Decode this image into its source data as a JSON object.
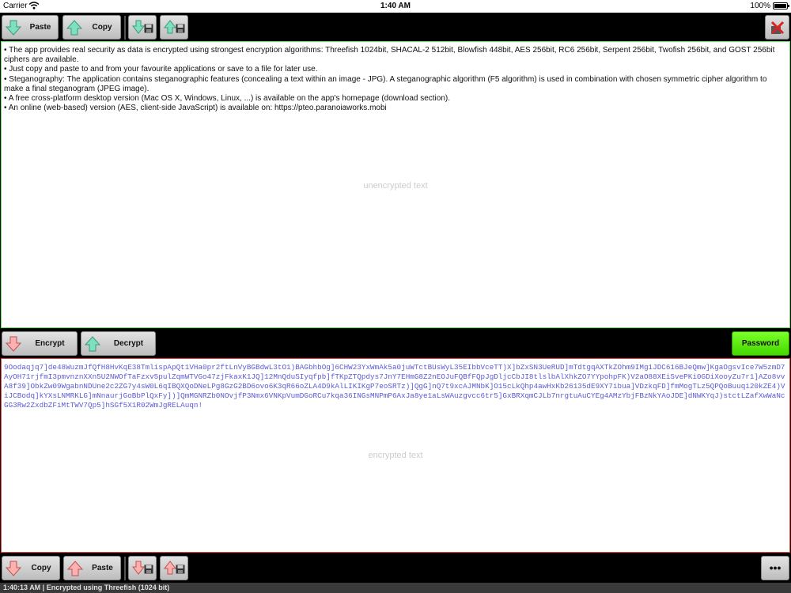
{
  "status": {
    "carrier": "Carrier",
    "time": "1:40 AM",
    "battery": "100%"
  },
  "toolbar_top": {
    "paste_label": "Paste",
    "copy_label": "Copy"
  },
  "plain": {
    "text": "• The app provides real security as data is encrypted using strongest encryption algorithms: Threefish 1024bit, SHACAL-2 512bit, Blowfish 448bit, AES 256bit, RC6 256bit, Serpent 256bit, Twofish 256bit, and GOST 256bit ciphers are available.\n• Just copy and paste to and from your favourite applications or save to a file for later use.\n• Steganography: The application contains steganographic features (concealing a text within an image - JPG). A steganographic algorithm (F5 algorithm) is used in combination with chosen symmetric cipher algorithm to make a final steganogram (JPEG image).\n• A free cross-platform desktop version (Mac OS X, Windows, Linux, ...) is available on the app's homepage (download section).\n• An online (web-based) version (AES, client-side JavaScript) is available on: https://pteo.paranoiaworks.mobi",
    "placeholder": "unencrypted text"
  },
  "middle": {
    "encrypt_label": "Encrypt",
    "decrypt_label": "Decrypt",
    "password_label": "Password"
  },
  "cipher": {
    "text": "9Oodaqjq7]de48WuzmJfQfH8HvKqE38TmlispApQt1VHa0pr2ftLnVyBGBdwL3tO1)BAGbhbOg]6CHW23YxWmAk5a0juWTctBUsWyL35EIbbVceTT)X]bZxSN3UeRUD]mTdtgqAXTkZOhm9IMg1JDC616BJeQmw]KgaOgsvIce7W5zmD7AyOH71rjfmI3pmvnznXXn5U2NWOfTaFzxv5pulZqmWTVGo47zjFkaxK1JQ]12MnQduSIyqfpb]fTKpZTQpdys7JnY7EHmG8Z2nEOJuFQBfFQpJgDljcCbJI8tlslbAlXhkZO7YYpohpFK)V2aO88XEiSvePKi0GDiXooyZu7r1]AZo8vvA8f39]ObkZw09WgabnNDUne2c2ZG7y4sW0L6qIBQXQoDNeLPg8GzG2BD6ovo6K3qR66oZLA4D9kAlLIKIKgP7eoSRTz)]QgG]nQ7t9xcAJMNbK]O15cLkQhp4awHxKb26135dE9XY7ibua]VDzkqFD]fmMogTLz5QPQoBuuqi20kZE4)ViJCBodq]kYXsLNMRKLG]mNnaurjGoBbPlQxFy])]QmMGNRZb0NOvjfP3Nmx6VNKpVumDGoRCu7kqa36INGsMNPmP6AxJa8ye1aLsWAuzgvcc6tr5]GxBRXqmCJLb7nrgtuAuCYEg4AMzYbjFBzNkYAoJDE]dNWKYqJ)stctLZafXwWaNcGG3Rw2ZxdbZFiMtTWV7Qp5]hSGf5X1R02WmJgRELAuqn!",
    "placeholder": "encrypted text"
  },
  "toolbar_bottom": {
    "copy_label": "Copy",
    "paste_label": "Paste",
    "more_label": "•••"
  },
  "footer": {
    "text": "1:40:13 AM | Encrypted using Threefish (1024 bit)"
  },
  "colors": {
    "plain_border": "#5ee65e",
    "cipher_border": "#e84444",
    "password_bg": "#44d800",
    "cipher_text": "#5a5ad8"
  },
  "icons": [
    "wifi-icon",
    "battery-icon",
    "arrow-down-icon",
    "arrow-up-icon",
    "save-icon",
    "clear-icon",
    "more-icon"
  ]
}
